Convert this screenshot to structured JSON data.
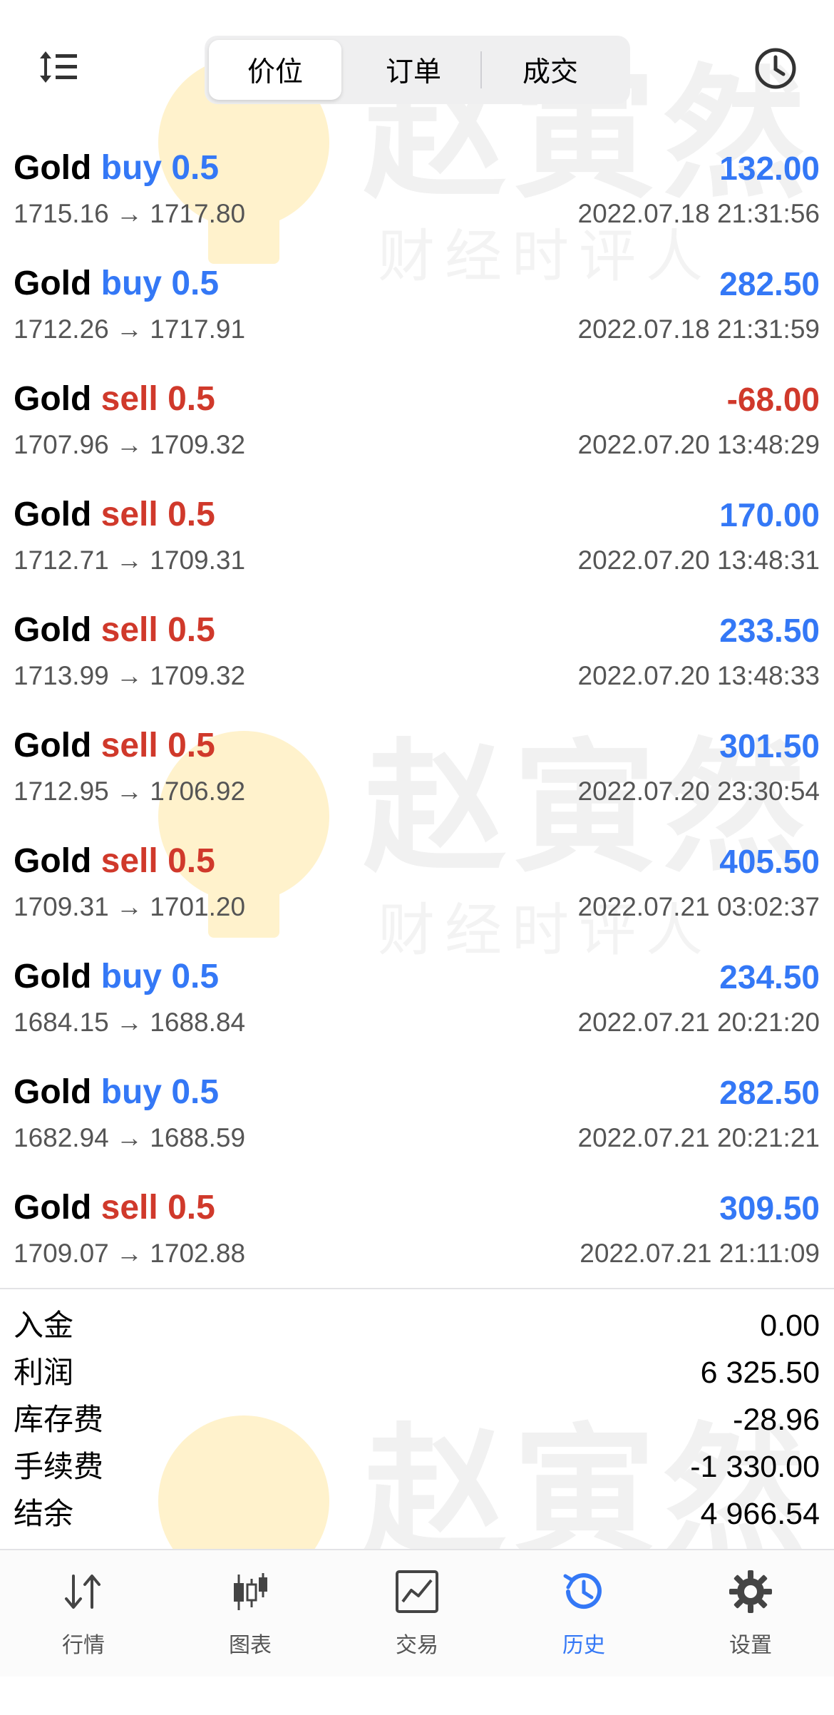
{
  "header": {
    "tabs": [
      {
        "label": "价位",
        "active": true
      },
      {
        "label": "订单",
        "active": false
      },
      {
        "label": "成交",
        "active": false
      }
    ],
    "left_icon": "sort-icon",
    "right_icon": "clock-icon"
  },
  "watermark": {
    "mark": "赵寅然",
    "subtitle": "财经时评人",
    "icon": "lightbulb-cup-logo"
  },
  "trades": [
    {
      "symbol": "Gold",
      "side": "buy",
      "volume": "0.5",
      "profit": "132.00",
      "profit_sign": "pos",
      "prices": "1715.16 → 1717.80",
      "time": "2022.07.18 21:31:56"
    },
    {
      "symbol": "Gold",
      "side": "buy",
      "volume": "0.5",
      "profit": "282.50",
      "profit_sign": "pos",
      "prices": "1712.26 → 1717.91",
      "time": "2022.07.18 21:31:59"
    },
    {
      "symbol": "Gold",
      "side": "sell",
      "volume": "0.5",
      "profit": "-68.00",
      "profit_sign": "neg",
      "prices": "1707.96 → 1709.32",
      "time": "2022.07.20 13:48:29"
    },
    {
      "symbol": "Gold",
      "side": "sell",
      "volume": "0.5",
      "profit": "170.00",
      "profit_sign": "pos",
      "prices": "1712.71 → 1709.31",
      "time": "2022.07.20 13:48:31"
    },
    {
      "symbol": "Gold",
      "side": "sell",
      "volume": "0.5",
      "profit": "233.50",
      "profit_sign": "pos",
      "prices": "1713.99 → 1709.32",
      "time": "2022.07.20 13:48:33"
    },
    {
      "symbol": "Gold",
      "side": "sell",
      "volume": "0.5",
      "profit": "301.50",
      "profit_sign": "pos",
      "prices": "1712.95 → 1706.92",
      "time": "2022.07.20 23:30:54"
    },
    {
      "symbol": "Gold",
      "side": "sell",
      "volume": "0.5",
      "profit": "405.50",
      "profit_sign": "pos",
      "prices": "1709.31 → 1701.20",
      "time": "2022.07.21 03:02:37"
    },
    {
      "symbol": "Gold",
      "side": "buy",
      "volume": "0.5",
      "profit": "234.50",
      "profit_sign": "pos",
      "prices": "1684.15 → 1688.84",
      "time": "2022.07.21 20:21:20"
    },
    {
      "symbol": "Gold",
      "side": "buy",
      "volume": "0.5",
      "profit": "282.50",
      "profit_sign": "pos",
      "prices": "1682.94 → 1688.59",
      "time": "2022.07.21 20:21:21"
    },
    {
      "symbol": "Gold",
      "side": "sell",
      "volume": "0.5",
      "profit": "309.50",
      "profit_sign": "pos",
      "prices": "1709.07 → 1702.88",
      "time": "2022.07.21 21:11:09"
    }
  ],
  "summary": [
    {
      "label": "入金",
      "value": "0.00"
    },
    {
      "label": "利润",
      "value": "6 325.50"
    },
    {
      "label": "库存费",
      "value": "-28.96"
    },
    {
      "label": "手续费",
      "value": "-1 330.00"
    },
    {
      "label": "结余",
      "value": "4 966.54"
    }
  ],
  "nav": [
    {
      "label": "行情",
      "icon": "arrows-updown-icon",
      "active": false
    },
    {
      "label": "图表",
      "icon": "candlestick-icon",
      "active": false
    },
    {
      "label": "交易",
      "icon": "trade-chart-icon",
      "active": false
    },
    {
      "label": "历史",
      "icon": "history-icon",
      "active": true
    },
    {
      "label": "设置",
      "icon": "gear-icon",
      "active": false
    }
  ],
  "colors": {
    "blue": "#3478f6",
    "red": "#d0392b",
    "gray_text": "#555555"
  }
}
